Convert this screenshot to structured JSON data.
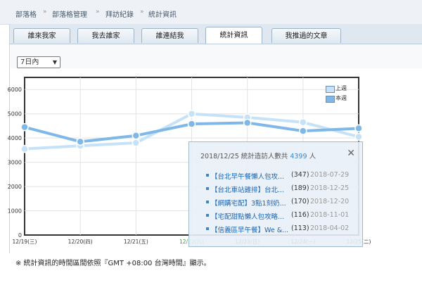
{
  "breadcrumb": {
    "items": [
      "部落格",
      "部落格管理",
      "拜訪紀錄",
      "統計資訊"
    ],
    "separator": "»"
  },
  "tabs": [
    {
      "label": "誰來我家"
    },
    {
      "label": "我去誰家"
    },
    {
      "label": "誰連結我"
    },
    {
      "label": "統計資訊",
      "active": true
    },
    {
      "label": "我推過的文章"
    }
  ],
  "period_select": {
    "value": "7日內"
  },
  "chart_data": {
    "type": "line",
    "categories": [
      "12/19(三)",
      "12/20(四)",
      "12/21(五)",
      "12/22(六)",
      "12/23(日)",
      "12/24(一)",
      "12/25(二)"
    ],
    "series": [
      {
        "name": "上週",
        "color": "#c6e2f8",
        "values": [
          3550,
          3680,
          3800,
          5000,
          4850,
          4650,
          4050
        ]
      },
      {
        "name": "本週",
        "color": "#7fb8e8",
        "values": [
          4450,
          3850,
          4100,
          4580,
          4630,
          4290,
          4399
        ]
      }
    ],
    "yticks": [
      0,
      1000,
      2000,
      3000,
      4000,
      5000,
      6000
    ],
    "ylim": [
      0,
      6500
    ],
    "grid": true,
    "legend": "top-right",
    "highlighted_category": "12/22(六)"
  },
  "tooltip": {
    "date": "2018/12/25",
    "label": "統計造訪人數共",
    "count": "4399",
    "unit": "人",
    "close": "✕",
    "items": [
      {
        "title": "【台北早午餐懶人包攻...",
        "count": "(347)",
        "date": "2018-07-29"
      },
      {
        "title": "【台北車站雞排】台北...",
        "count": "(189)",
        "date": "2018-12-25"
      },
      {
        "title": "【網購宅配】3點1刻奶...",
        "count": "(170)",
        "date": "2018-12-20"
      },
      {
        "title": "【宅配甜點懶人包攻略...",
        "count": "(116)",
        "date": "2018-11-01"
      },
      {
        "title": "【信義區早午餐】We &...",
        "count": "(113)",
        "date": "2018-04-02"
      }
    ]
  },
  "footnote": "※ 統計資訊的時間區間依照『GMT +08:00 台灣時間』顯示。"
}
